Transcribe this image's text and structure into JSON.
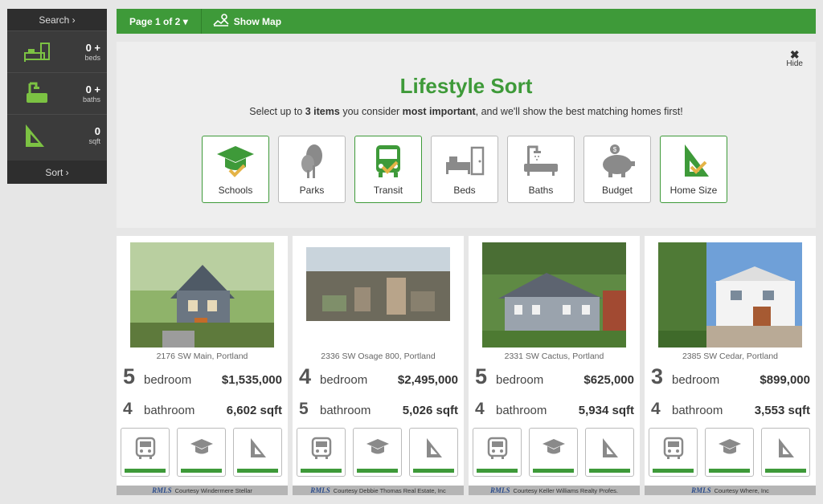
{
  "sidebar": {
    "search_label": "Search ›",
    "sort_label": "Sort ›",
    "rows": [
      {
        "value": "0 +",
        "unit": "beds",
        "icon": "bed-icon"
      },
      {
        "value": "0 +",
        "unit": "baths",
        "icon": "bath-icon"
      },
      {
        "value": "0",
        "unit": "sqft",
        "icon": "set-square-icon"
      }
    ]
  },
  "topbar": {
    "page_label": "Page 1 of 2 ▾",
    "map_label": "Show Map"
  },
  "lifestyle": {
    "hide_x": "✖",
    "hide_label": "Hide",
    "title": "Lifestyle Sort",
    "subtitle_1": "Select up to ",
    "subtitle_2": "3 items",
    "subtitle_3": " you consider ",
    "subtitle_4": "most important",
    "subtitle_5": ", and we'll show the best matching homes first!",
    "categories": [
      {
        "label": "Schools",
        "selected": true
      },
      {
        "label": "Parks",
        "selected": false
      },
      {
        "label": "Transit",
        "selected": true
      },
      {
        "label": "Beds",
        "selected": false
      },
      {
        "label": "Baths",
        "selected": false
      },
      {
        "label": "Budget",
        "selected": false
      },
      {
        "label": "Home Size",
        "selected": true
      }
    ]
  },
  "listings": [
    {
      "address": "2176 SW Main, Portland",
      "beds": "5",
      "bed_label": "bedroom",
      "price": "$1,535,000",
      "baths": "4",
      "bath_label": "bathroom",
      "sqft": "6,602 sqft",
      "credit": "Courtesy Windermere Stellar"
    },
    {
      "address": "2336 SW Osage 800, Portland",
      "beds": "4",
      "bed_label": "bedroom",
      "price": "$2,495,000",
      "baths": "5",
      "bath_label": "bathroom",
      "sqft": "5,026 sqft",
      "credit": "Courtesy Debbie Thomas Real Estate, Inc"
    },
    {
      "address": "2331 SW Cactus, Portland",
      "beds": "5",
      "bed_label": "bedroom",
      "price": "$625,000",
      "baths": "4",
      "bath_label": "bathroom",
      "sqft": "5,934 sqft",
      "credit": "Courtesy Keller Williams Realty Profes."
    },
    {
      "address": "2385 SW Cedar, Portland",
      "beds": "3",
      "bed_label": "bedroom",
      "price": "$899,000",
      "baths": "4",
      "bath_label": "bathroom",
      "sqft": "3,553 sqft",
      "credit": "Courtesy Where, Inc"
    }
  ],
  "rmls_logo": "RMLS",
  "colors": {
    "accent": "#3e9a39",
    "sidebar": "#3b3b3b",
    "icon_gray": "#8a8a8a"
  }
}
